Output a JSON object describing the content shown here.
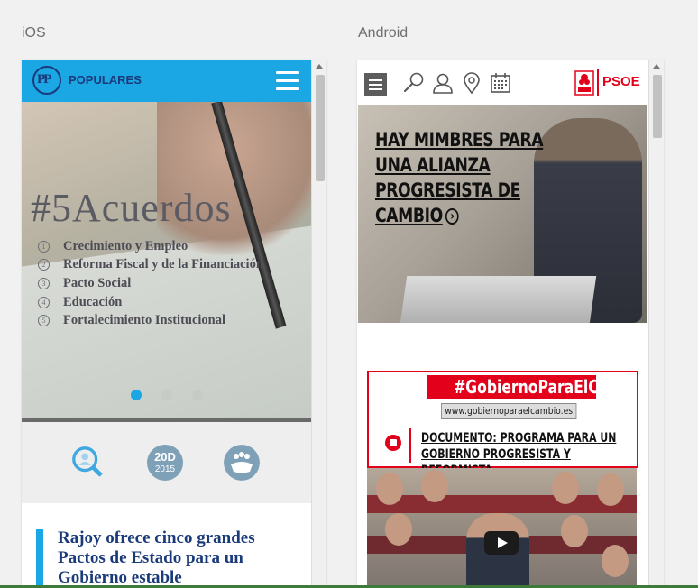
{
  "labels": {
    "ios": "iOS",
    "android": "Android"
  },
  "ios": {
    "brand": "POPULARES",
    "logo_text": "PP",
    "slide": {
      "title": "#5Acuerdos",
      "items": [
        {
          "num": "1",
          "text": "Crecimiento y Empleo"
        },
        {
          "num": "2",
          "text": "Reforma Fiscal y de la Financiación"
        },
        {
          "num": "3",
          "text": "Pacto Social"
        },
        {
          "num": "4",
          "text": "Educación"
        },
        {
          "num": "5",
          "text": "Fortalecimiento Institucional"
        }
      ],
      "dots": 3,
      "active_dot": 0
    },
    "icons": {
      "badge_line1": "20D",
      "badge_line2": "2015"
    },
    "news_title": "Rajoy ofrece cinco grandes Pactos de Estado para un Gobierno estable"
  },
  "android": {
    "brand": "PSOE",
    "hero_title": "HAY MIMBRES PARA UNA ALIANZA PROGRESISTA DE CAMBIO",
    "hero_arrow": "›",
    "banner": {
      "hashtag": "#GobiernoParaElCambio",
      "url": "www.gobiernoparaelcambio.es",
      "document": "DOCUMENTO: PROGRAMA PARA UN GOBIERNO PROGRESISTA Y REFORMISTA"
    }
  },
  "colors": {
    "pp_blue": "#1ba6e4",
    "pp_navy": "#1a3a7a",
    "psoe_red": "#e2001a"
  }
}
